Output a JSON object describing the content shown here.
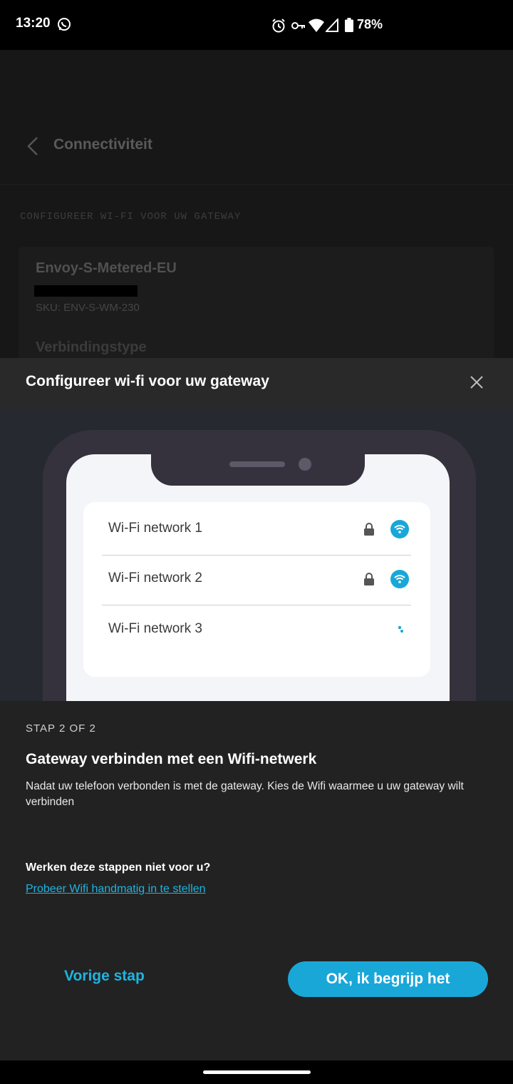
{
  "status_bar": {
    "time": "13:20",
    "battery": "78%",
    "icons": [
      "whatsapp-icon",
      "alarm-icon",
      "vpn-key-icon",
      "wifi-icon",
      "cell-signal-icon",
      "battery-icon"
    ]
  },
  "background_page": {
    "title": "Connectiviteit",
    "section_label": "CONFIGUREER WI-FI VOOR UW GATEWAY",
    "device_name": "Envoy-S-Metered-EU",
    "sku": "SKU: ENV-S-WM-230",
    "connection_type_label": "Verbindingstype"
  },
  "modal": {
    "title": "Configureer wi-fi voor uw gateway",
    "illustration": {
      "networks": [
        {
          "name": "Wi-Fi network 1",
          "locked": true,
          "icon": "wifi-icon"
        },
        {
          "name": "Wi-Fi network 2",
          "locked": true,
          "icon": "wifi-icon"
        },
        {
          "name": "Wi-Fi network 3",
          "locked": false,
          "icon": "loading-icon"
        }
      ]
    },
    "step": "STAP 2 OF 2",
    "heading": "Gateway verbinden met een Wifi-netwerk",
    "description": "Nadat uw telefoon verbonden is met de gateway. Kies de Wifi waarmee u uw gateway wilt verbinden",
    "help_question": "Werken deze stappen niet voor u?",
    "help_link": "Probeer Wifi handmatig in te stellen",
    "prev_button": "Vorige stap",
    "ok_button": "OK, ik begrijp het"
  },
  "colors": {
    "accent": "#19a7d8",
    "link": "#1fb4e0",
    "modal_background": "#222222"
  }
}
